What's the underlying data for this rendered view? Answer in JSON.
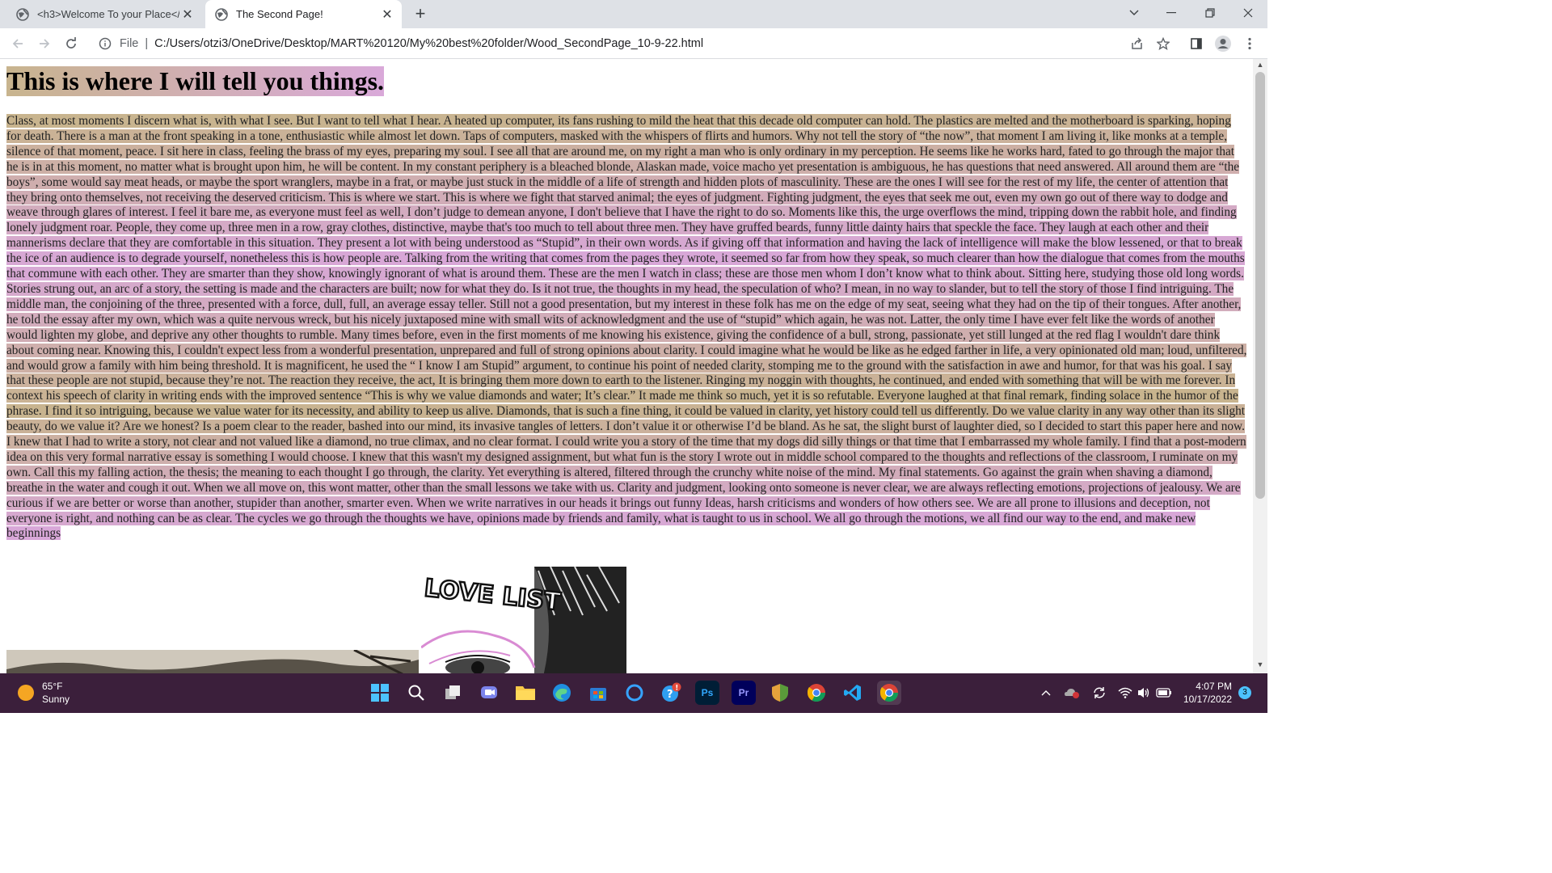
{
  "browser": {
    "tabs": [
      {
        "title": "<h3>Welcome To your Place</h",
        "active": false
      },
      {
        "title": "The Second Page!",
        "active": true
      }
    ],
    "new_tab_label": "+",
    "address_bar": {
      "scheme_label": "File",
      "separator": "|",
      "url": "C:/Users/otzi3/OneDrive/Desktop/MART%20120/My%20best%20folder/Wood_SecondPage_10-9-22.html"
    }
  },
  "page": {
    "heading": "This is where I will tell you things.",
    "essay": "Class, at most moments I discern what is, with what I see. But I want to tell what I hear. A heated up computer, its fans rushing to mild the heat that this decade old computer can hold. The plastics are melted and the motherboard is sparking, hoping for death. There is a man at the front speaking in a tone, enthusiastic while almost let down. Taps of computers, masked with the whispers of flirts and humors. Why not tell the story of “the now”, that moment I am living it, like monks at a temple, silence of that moment, peace. I sit here in class, feeling the brass of my eyes, preparing my soul. I see all that are around me, on my right a man who is only ordinary in my perception. He seems like he works hard, fated to go through the major that he is in at this moment, no matter what is brought upon him, he will be content. In my constant periphery is a bleached blonde, Alaskan made, voice macho yet presentation is ambiguous, he has questions that need answered. All around them are “the boys”, some would say meat heads, or maybe the sport wranglers, maybe in a frat, or maybe just stuck in the middle of a life of strength and hidden plots of masculinity. These are the ones I will see for the rest of my life, the center of attention that they bring onto themselves, not receiving the deserved criticism. This is where we start. This is where we fight that starved animal; the eyes of judgment. Fighting judgment, the eyes that seek me out, even my own go out of there way to dodge and weave through glares of interest. I feel it bare me, as everyone must feel as well, I don’t judge to demean anyone, I don't believe that I have the right to do so. Moments like this, the urge overflows the mind, tripping down the rabbit hole, and finding lonely judgment roar. People, they come up, three men in a row, gray clothes, distinctive, maybe that's too much to tell about three men. They have gruffed beards, funny little dainty hairs that speckle the face. They laugh at each other and their mannerisms declare that they are comfortable in this situation. They present a lot with being understood as “Stupid”, in their own words. As if giving off that information and having the lack of intelligence will make the blow lessened, or that to break the ice of an audience is to degrade yourself, nonetheless this is how people are. Talking from the writing that comes from the pages they wrote, it seemed so far from how they speak, so much clearer than how the dialogue that comes from the mouths that commune with each other. They are smarter than they show, knowingly ignorant of what is around them. These are the men I watch in class; these are those men whom I don’t know what to think about. Sitting here, studying those old long words. Stories strung out, an arc of a story, the setting is made and the characters are built; now for what they do. Is it not true, the thoughts in my head, the speculation of who? I mean, in no way to slander, but to tell the story of those I find intriguing. The middle man, the conjoining of the three, presented with a force, dull, full, an average essay teller. Still not a good presentation, but my interest in these folk has me on the edge of my seat, seeing what they had on the tip of their tongues. After another, he told the essay after my own, which was a quite nervous wreck, but his nicely juxtaposed mine with small wits of acknowledgment and the use of “stupid” which again, he was not. Latter, the only time I have ever felt like the words of another would lighten my globe, and deprive any other thoughts to rumble. Many times before, even in the first moments of me knowing his existence, giving the confidence of a bull, strong, passionate, yet still lunged at the red flag I wouldn't dare think about coming near. Knowing this, I couldn't expect less from a wonderful presentation, unprepared and full of strong opinions about clarity. I could imagine what he would be like as he edged farther in life, a very opinionated old man; loud, unfiltered, and would grow a family with him being threshold. It is magnificent, he used the “ I know I am Stupid” argument, to continue his point of needed clarity, stomping me to the ground with the satisfaction in awe and humor, for that was his goal. I say that these people are not stupid, because they’re not. The reaction they receive, the act, It is bringing them more down to earth to the listener. Ringing my noggin with thoughts, he continued, and ended with something that will be with me forever. In context his speech of clarity in writing ends with the improved sentence “This is why we value diamonds and water; It’s clear.” It made me think so much, yet it is so refutable. Everyone laughed at that final remark, finding solace in the humor of the phrase. I find it so intriguing, because we value water for its necessity, and ability to keep us alive. Diamonds, that is such a fine thing, it could be valued in clarity, yet history could tell us differently. Do we value clarity in any way other than its slight beauty, do we value it? Are we honest? Is a poem clear to the reader, bashed into our mind, its invasive tangles of letters. I don’t value it or otherwise I’d be bland. As he sat, the slight burst of laughter died, so I decided to start this paper here and now. I knew that I had to write a story, not clear and not valued like a diamond, no true climax, and no clear format. I could write you a story of the time that my dogs did silly things or that time that I embarrassed my whole family. I find that a post-modern idea on this very formal narrative essay is something I would choose. I knew that this wasn't my designed assignment, but what fun is the story I wrote out in middle school compared to the thoughts and reflections of the classroom, I ruminate on my own. Call this my falling action, the thesis; the meaning to each thought I go through, the clarity. Yet everything is altered, filtered through the crunchy white noise of the mind. My final statements. Go against the grain when shaving a diamond, breathe in the water and cough it out. When we all move on, this wont matter, other than the small lessons we take with us. Clarity and judgment, looking onto someone is never clear, we are always reflecting emotions, projections of jealousy. We are curious if we are better or worse than another, stupider than another, smarter even. When we write narratives in our heads it brings out funny Ideas, harsh criticisms and wonders of how others see. We are all prone to illusions and deception, not everyone is right, and nothing can be as clear. The cycles we go through the thoughts we have, opinions made by friends and family, what is taught to us in school. We all go through the motions, we all find our way to the end, and make new beginnings",
    "image_right_lettering": "LOVE LIST"
  },
  "taskbar": {
    "weather_temp": "65°F",
    "weather_desc": "Sunny",
    "time": "4:07 PM",
    "date": "10/17/2022",
    "notification_count": "3"
  },
  "colors": {
    "highlight_tan": "#c8b48e",
    "highlight_pink": "#d8a7d8",
    "taskbar_bg": "#3b1f3b"
  }
}
